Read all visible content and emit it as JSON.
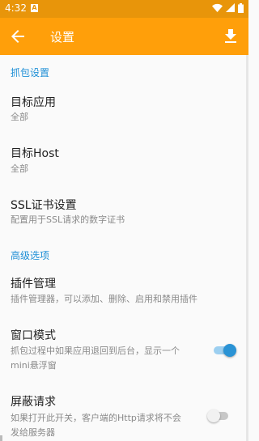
{
  "status_bar": {
    "time": "4:32",
    "notification_glyph": "A"
  },
  "toolbar": {
    "title": "设置",
    "back_icon": "arrow-back-icon",
    "download_icon": "download-icon"
  },
  "sections": [
    {
      "header": "抓包设置",
      "items": [
        {
          "title": "目标应用",
          "summary": "全部"
        },
        {
          "title": "目标Host",
          "summary": "全部"
        },
        {
          "title": "SSL证书设置",
          "summary": "配置用于SSL请求的数字证书"
        }
      ]
    },
    {
      "header": "高级选项",
      "items": [
        {
          "title": "插件管理",
          "summary": "插件管理器，可以添加、删除、启用和禁用插件"
        },
        {
          "title": "窗口模式",
          "summary_line1": "抓包过程中如果应用退回到后台，显示一个",
          "summary_line2": "mini悬浮窗",
          "switch": "on"
        },
        {
          "title": "屏蔽请求",
          "summary_line1": "如果打开此开关，客户端的Http请求将不会",
          "summary_line2": "发给服务器",
          "switch": "off"
        }
      ]
    }
  ],
  "colors": {
    "status_bar": "#e8950a",
    "toolbar": "#ff9f0a",
    "accent": "#2a93d5",
    "section_header": "#1e8fd6"
  }
}
